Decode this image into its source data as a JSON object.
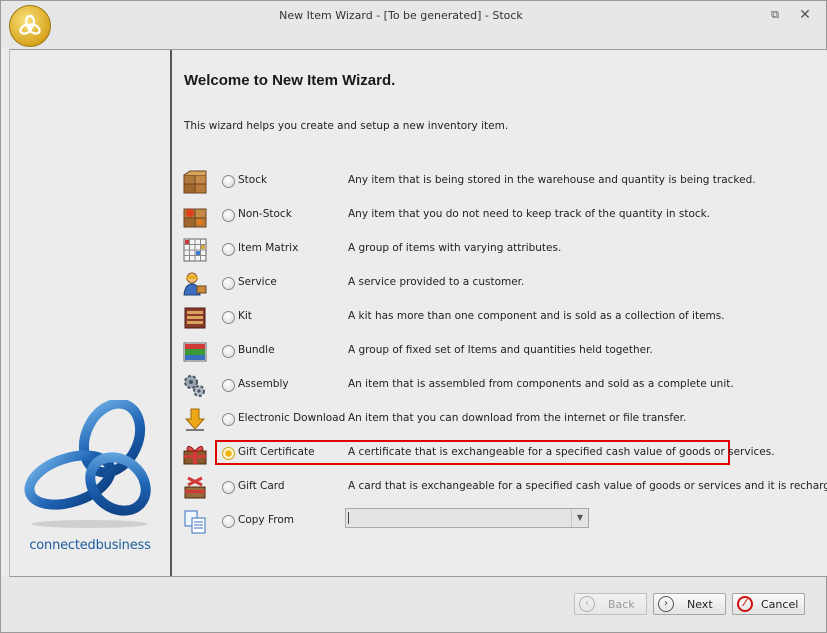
{
  "window": {
    "title": "New Item Wizard - [To be generated] - Stock",
    "restore_glyph": "⧉",
    "close_glyph": "✕"
  },
  "sidebar": {
    "brand_name": "connectedbusiness"
  },
  "wizard": {
    "title": "Welcome to New Item Wizard.",
    "intro": "This wizard helps you create and setup a new inventory item.",
    "selected": "Gift Certificate",
    "options": [
      {
        "label": "Stock",
        "description": "Any item that is being stored in the warehouse and quantity is being tracked.",
        "icon": "stock-box-icon",
        "checked": false
      },
      {
        "label": "Non-Stock",
        "description": "Any item that you do not need to keep track of the quantity in stock.",
        "icon": "non-stock-box-icon",
        "checked": false
      },
      {
        "label": "Item Matrix",
        "description": "A group of items with varying attributes.",
        "icon": "item-matrix-grid-icon",
        "checked": false
      },
      {
        "label": "Service",
        "description": "A service provided to a customer.",
        "icon": "service-person-icon",
        "checked": false
      },
      {
        "label": "Kit",
        "description": "A kit has more than one component and is sold as a collection of items.",
        "icon": "kit-box-icon",
        "checked": false
      },
      {
        "label": "Bundle",
        "description": "A group of fixed set of Items and quantities held together.",
        "icon": "bundle-icon",
        "checked": false
      },
      {
        "label": "Assembly",
        "description": "An item that is assembled from components and sold as a complete unit.",
        "icon": "assembly-gears-icon",
        "checked": false
      },
      {
        "label": "Electronic Download",
        "description": "An item that you can download from the internet or file transfer.",
        "icon": "download-arrow-icon",
        "checked": false
      },
      {
        "label": "Gift Certificate",
        "description": "A certificate that is exchangeable for a specified cash value of goods or services.",
        "icon": "gift-certificate-icon",
        "checked": true
      },
      {
        "label": "Gift Card",
        "description": "A card that is exchangeable for a specified cash value of goods or services and it is rechargeable.",
        "icon": "gift-card-icon",
        "checked": false
      },
      {
        "label": "Copy From",
        "description": "",
        "icon": "copy-from-icon",
        "checked": false
      }
    ],
    "copy_from_value": ""
  },
  "footer": {
    "back_label": "Back",
    "next_label": "Next",
    "cancel_label": "Cancel"
  },
  "colors": {
    "highlight_border": "#e00000",
    "brand_blue": "#1d5a9c"
  }
}
